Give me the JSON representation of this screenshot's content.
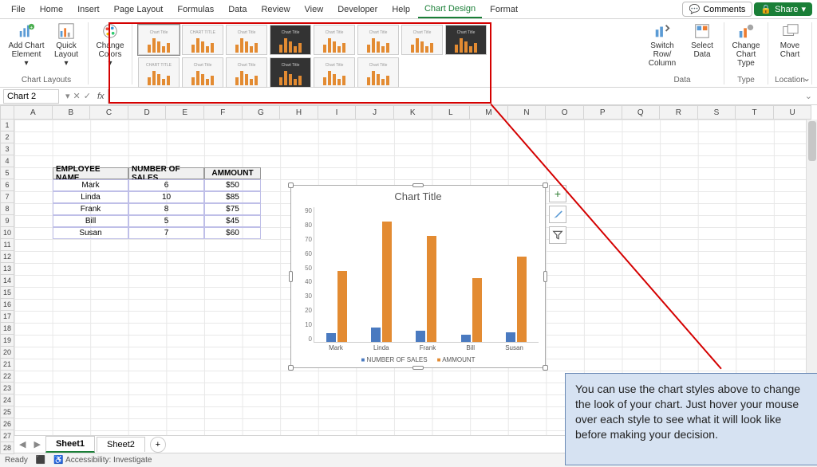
{
  "tabs": [
    "File",
    "Home",
    "Insert",
    "Page Layout",
    "Formulas",
    "Data",
    "Review",
    "View",
    "Developer",
    "Help",
    "Chart Design",
    "Format"
  ],
  "active_tab": "Chart Design",
  "header_buttons": {
    "comments": "Comments",
    "share": "Share"
  },
  "ribbon": {
    "layouts_group_label": "Chart Layouts",
    "add_element": "Add Chart Element",
    "quick_layout": "Quick Layout",
    "change_colors": "Change Colors",
    "data_group_label": "Data",
    "switch": "Switch Row/ Column",
    "select_data": "Select Data",
    "type_group_label": "Type",
    "change_type": "Change Chart Type",
    "location_group_label": "Location",
    "move_chart": "Move Chart"
  },
  "namebox": "Chart 2",
  "columns": [
    "A",
    "B",
    "C",
    "D",
    "E",
    "F",
    "G",
    "H",
    "I",
    "J",
    "K",
    "L",
    "M",
    "N",
    "O",
    "P",
    "Q",
    "R",
    "S",
    "T",
    "U"
  ],
  "row_count": 28,
  "sheet_tabs": [
    "Sheet1",
    "Sheet2"
  ],
  "active_sheet": "Sheet1",
  "status": {
    "ready": "Ready",
    "accessibility": "Accessibility: Investigate"
  },
  "table": {
    "headers": [
      "EMPLOYEE NAME",
      "NUMBER OF SALES",
      "AMMOUNT"
    ],
    "rows": [
      [
        "Mark",
        "6",
        "$50"
      ],
      [
        "Linda",
        "10",
        "$85"
      ],
      [
        "Frank",
        "8",
        "$75"
      ],
      [
        "Bill",
        "5",
        "$45"
      ],
      [
        "Susan",
        "7",
        "$60"
      ]
    ]
  },
  "chart_data": {
    "type": "bar",
    "title": "Chart Title",
    "categories": [
      "Mark",
      "Linda",
      "Frank",
      "Bill",
      "Susan"
    ],
    "series": [
      {
        "name": "NUMBER OF SALES",
        "values": [
          6,
          10,
          8,
          5,
          7
        ]
      },
      {
        "name": "AMMOUNT",
        "values": [
          50,
          85,
          75,
          45,
          60
        ]
      }
    ],
    "ylim": [
      0,
      90
    ],
    "yticks": [
      0,
      10,
      20,
      30,
      40,
      50,
      60,
      70,
      80,
      90
    ]
  },
  "callout_text": "You can use the chart styles above to change the look of your chart. Just hover your mouse over each style to see what it will look like before making your decision."
}
